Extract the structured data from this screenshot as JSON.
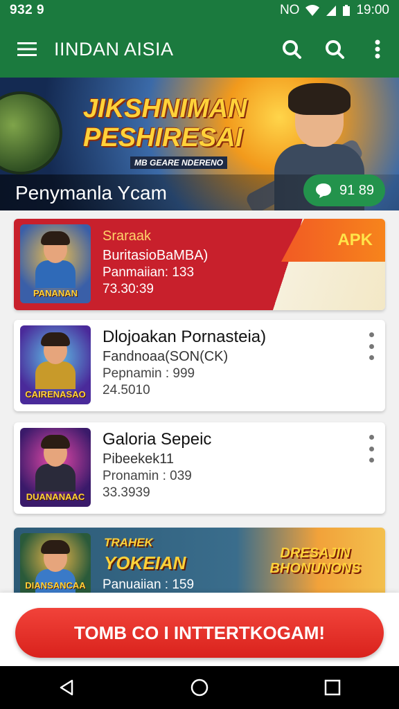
{
  "status_bar": {
    "time_left": "932 9",
    "network": "NO",
    "clock": "19:00"
  },
  "app_bar": {
    "title": "IINDAN AISIA",
    "icons": [
      "menu-icon",
      "search-icon",
      "search-icon",
      "more-vert-icon"
    ]
  },
  "banner": {
    "title_line1": "JIKSHNIMAN",
    "title_line2": "PESHIRESAI",
    "subtitle": "MB GEARE NDERENO",
    "caption": "Penymanla Ycam",
    "comment_count": "91 89"
  },
  "cards": [
    {
      "thumb_label": "PANANAN",
      "line1": "Sraraak",
      "line2": "BuritasioBaMBA)",
      "line3": "Panmaiian: 133",
      "line4": "73.30:39",
      "tag": "APK",
      "colors": {
        "bg": "#c8202c",
        "accent": "#f7841c"
      }
    },
    {
      "thumb_label": "CAIRENASAO",
      "line1": "Dlojoakan Pornasteia)",
      "line2": "Fandnoaa(SON(CK)",
      "line3": "Pepnamin : 999",
      "line4": "24.5010"
    },
    {
      "thumb_label": "DUANANAAC",
      "line1": "Galoria Sepeic",
      "line2": "Pibeekek11",
      "line3": "Pronamin : 039",
      "line4": "33.3939"
    }
  ],
  "promo": {
    "thumb_label": "DIANSANCAA",
    "title_line1": "TRAHEK",
    "title_line2": "YOKEIAN",
    "badge": "DRESAJIN BHONUNONS",
    "meta": "Panuaiian : 159"
  },
  "cta": {
    "label": "TOMB CO I INTTERTKOGAM!"
  },
  "colors": {
    "primary": "#1b7a3e",
    "cta": "#e22b24"
  }
}
